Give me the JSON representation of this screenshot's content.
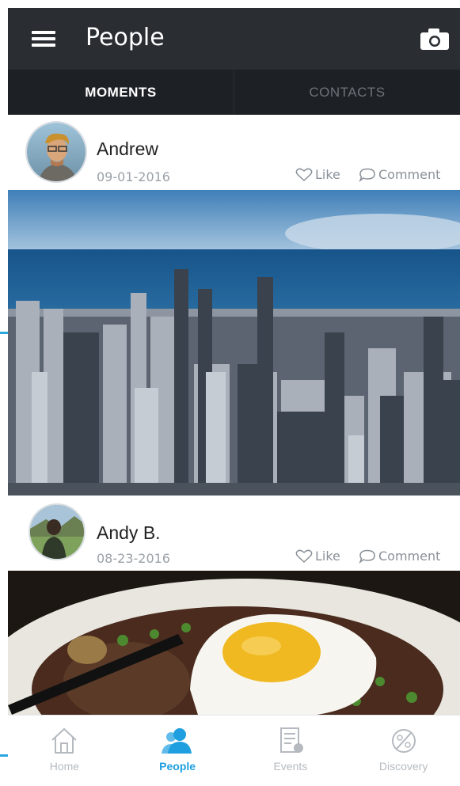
{
  "header": {
    "title": "People"
  },
  "tabs": [
    {
      "label": "MOMENTS",
      "active": true
    },
    {
      "label": "CONTACTS",
      "active": false
    }
  ],
  "posts": [
    {
      "author": "Andrew",
      "date": "09-01-2016",
      "like_label": "Like",
      "comment_label": "Comment",
      "photo": "city skyline"
    },
    {
      "author": "Andy B.",
      "date": "08-23-2016",
      "like_label": "Like",
      "comment_label": "Comment",
      "photo": "fried egg plate"
    }
  ],
  "bottom_nav": [
    {
      "label": "Home",
      "icon": "home-icon",
      "active": false
    },
    {
      "label": "People",
      "icon": "people-icon",
      "active": true
    },
    {
      "label": "Events",
      "icon": "events-icon",
      "active": false
    },
    {
      "label": "Discovery",
      "icon": "discovery-icon",
      "active": false
    }
  ],
  "colors": {
    "appbar": "#2a2e33",
    "tabbar": "#1d2024",
    "accent": "#1f9fe0"
  }
}
